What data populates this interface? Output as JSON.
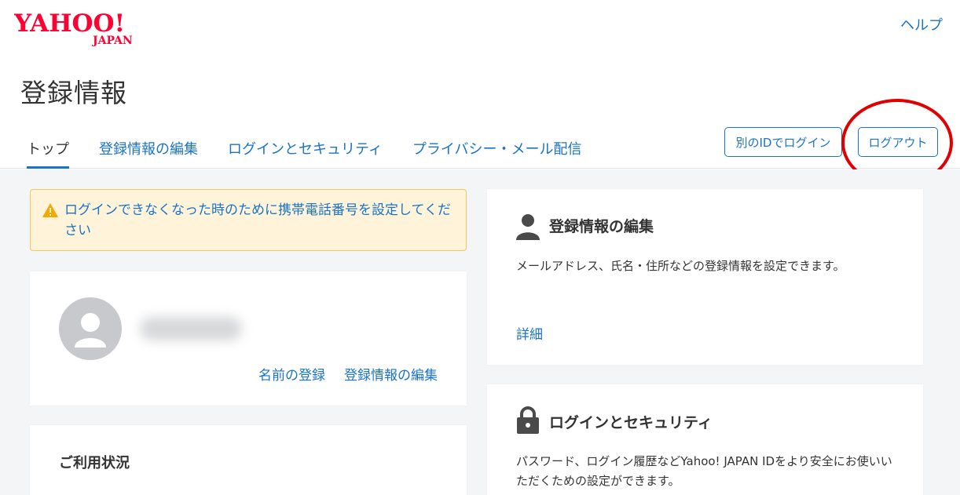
{
  "brand": {
    "logo_main": "YAHOO!",
    "logo_sub": "JAPAN",
    "accent": "#ff0033",
    "link_color": "#1a73c6"
  },
  "header": {
    "help_label": "ヘルプ",
    "page_title": "登録情報"
  },
  "tabs": [
    {
      "label": "トップ",
      "active": true
    },
    {
      "label": "登録情報の編集",
      "active": false
    },
    {
      "label": "ログインとセキュリティ",
      "active": false
    },
    {
      "label": "プライバシー・メール配信",
      "active": false
    }
  ],
  "actions": {
    "login_other_id": "別のIDでログイン",
    "logout": "ログアウト"
  },
  "alert": {
    "icon": "warning-icon",
    "text": "ログインできなくなった時のために携帯電話番号を設定してください"
  },
  "profile": {
    "name_registration_link": "名前の登録",
    "edit_info_link": "登録情報の編集"
  },
  "usage": {
    "title": "ご利用状況"
  },
  "cards": {
    "edit": {
      "icon": "person-icon",
      "title": "登録情報の編集",
      "description": "メールアドレス、氏名・住所などの登録情報を設定できます。",
      "link": "詳細"
    },
    "security": {
      "icon": "lock-icon",
      "title": "ログインとセキュリティ",
      "description": "パスワード、ログイン履歴などYahoo! JAPAN IDをより安全にお使いいただくための設定ができます。"
    }
  }
}
